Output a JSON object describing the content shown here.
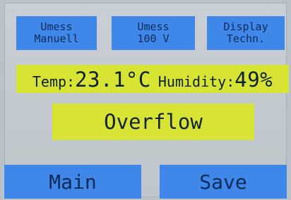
{
  "top_buttons": [
    {
      "line1": "Umess",
      "line2": "Manuell"
    },
    {
      "line1": "Umess",
      "line2": "100 V"
    },
    {
      "line1": "Display",
      "line2": "Techn."
    }
  ],
  "sensor": {
    "temp_label": "Temp:",
    "temp_value": "23.1°C",
    "humidity_label": "Humidity:",
    "humidity_value": "49%"
  },
  "status": {
    "text": "Overflow"
  },
  "bottom_buttons": {
    "main": "Main",
    "save": "Save"
  },
  "colors": {
    "button": "#3f87e8",
    "highlight": "#d7e434",
    "background": "#c5ccd1"
  }
}
